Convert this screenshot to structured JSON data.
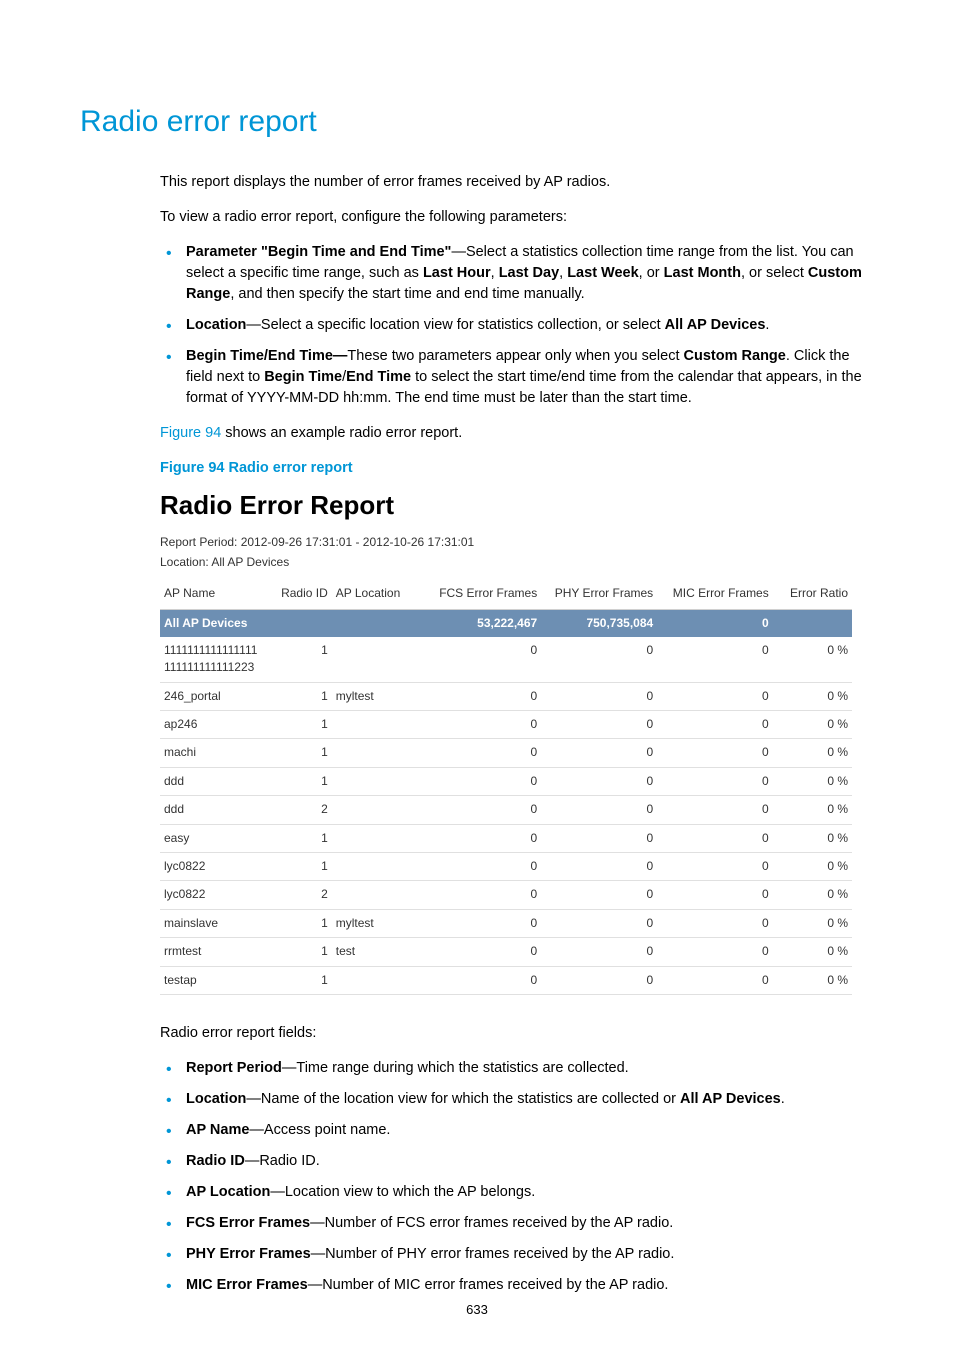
{
  "title": "Radio error report",
  "intro1": "This report displays the number of error frames received by AP radios.",
  "intro2": "To view a radio error report, configure the following parameters:",
  "params": [
    {
      "label": "Parameter \"Begin Time and End Time\"",
      "desc_a": "—Select a statistics collection time range from the list. You can select a specific time range, such as ",
      "opt1": "Last Hour",
      "sep1": ", ",
      "opt2": "Last Day",
      "sep2": ", ",
      "opt3": "Last Week",
      "sep3": ", or ",
      "opt4": "Last Month",
      "sep4": ", or select ",
      "opt5": "Custom Range",
      "desc_b": ", and then specify the start time and end time manually."
    },
    {
      "label": "Location",
      "desc_a": "—Select a specific location view for statistics collection, or select ",
      "opt1": "All AP Devices",
      "desc_b": "."
    },
    {
      "label": "Begin Time/End Time",
      "dash": "—",
      "desc_a": "These two parameters appear only when you select ",
      "opt1": "Custom Range",
      "desc_b": ". Click the field next to ",
      "opt2": "Begin Time",
      "slash": "/",
      "opt3": "End Time",
      "desc_c": " to select the start time/end time from the calendar that appears, in the format of YYYY-MM-DD hh:mm. The end time must be later than the start time."
    }
  ],
  "figref": {
    "link": "Figure 94",
    "tail": " shows an example radio error report."
  },
  "fig_caption": "Figure 94 Radio error report",
  "shot": {
    "title": "Radio Error Report",
    "period": "Report Period: 2012-09-26 17:31:01  -  2012-10-26 17:31:01",
    "location": "Location: All AP Devices",
    "headers": [
      "AP Name",
      "Radio ID",
      "AP Location",
      "FCS Error Frames",
      "PHY Error Frames",
      "MIC Error Frames",
      "Error Ratio"
    ],
    "summary": {
      "name": "All AP Devices",
      "fcs": "53,222,467",
      "phy": "750,735,084",
      "mic": "0"
    },
    "rows": [
      {
        "name": "1111111111111111111111111111223",
        "radio": "1",
        "loc": "",
        "fcs": "0",
        "phy": "0",
        "mic": "0",
        "err": "0 %"
      },
      {
        "name": "246_portal",
        "radio": "1",
        "loc": "myltest",
        "fcs": "0",
        "phy": "0",
        "mic": "0",
        "err": "0 %"
      },
      {
        "name": "ap246",
        "radio": "1",
        "loc": "",
        "fcs": "0",
        "phy": "0",
        "mic": "0",
        "err": "0 %"
      },
      {
        "name": "machi",
        "radio": "1",
        "loc": "",
        "fcs": "0",
        "phy": "0",
        "mic": "0",
        "err": "0 %"
      },
      {
        "name": "ddd",
        "radio": "1",
        "loc": "",
        "fcs": "0",
        "phy": "0",
        "mic": "0",
        "err": "0 %"
      },
      {
        "name": "ddd",
        "radio": "2",
        "loc": "",
        "fcs": "0",
        "phy": "0",
        "mic": "0",
        "err": "0 %"
      },
      {
        "name": "easy",
        "radio": "1",
        "loc": "",
        "fcs": "0",
        "phy": "0",
        "mic": "0",
        "err": "0 %"
      },
      {
        "name": "lyc0822",
        "radio": "1",
        "loc": "",
        "fcs": "0",
        "phy": "0",
        "mic": "0",
        "err": "0 %"
      },
      {
        "name": "lyc0822",
        "radio": "2",
        "loc": "",
        "fcs": "0",
        "phy": "0",
        "mic": "0",
        "err": "0 %"
      },
      {
        "name": "mainslave",
        "radio": "1",
        "loc": "myltest",
        "fcs": "0",
        "phy": "0",
        "mic": "0",
        "err": "0 %"
      },
      {
        "name": "rrmtest",
        "radio": "1",
        "loc": "test",
        "fcs": "0",
        "phy": "0",
        "mic": "0",
        "err": "0 %"
      },
      {
        "name": "testap",
        "radio": "1",
        "loc": "",
        "fcs": "0",
        "phy": "0",
        "mic": "0",
        "err": "0 %"
      }
    ]
  },
  "fields_intro": "Radio error report fields:",
  "fields": [
    {
      "label": "Report Period",
      "desc": "—Time range during which the statistics are collected."
    },
    {
      "label": "Location",
      "desc_a": "—Name of the location view for which the statistics are collected or ",
      "opt": "All AP Devices",
      "desc_b": "."
    },
    {
      "label": "AP Name",
      "desc": "—Access point name."
    },
    {
      "label": "Radio ID",
      "desc": "—Radio ID."
    },
    {
      "label": "AP Location",
      "desc": "—Location view to which the AP belongs."
    },
    {
      "label": "FCS Error Frames",
      "desc": "—Number of FCS error frames received by the AP radio."
    },
    {
      "label": "PHY Error Frames",
      "desc": "—Number of PHY error frames received by the AP radio."
    },
    {
      "label": "MIC Error Frames",
      "desc": "—Number of MIC error frames received by the AP radio."
    }
  ],
  "page_number": "633"
}
